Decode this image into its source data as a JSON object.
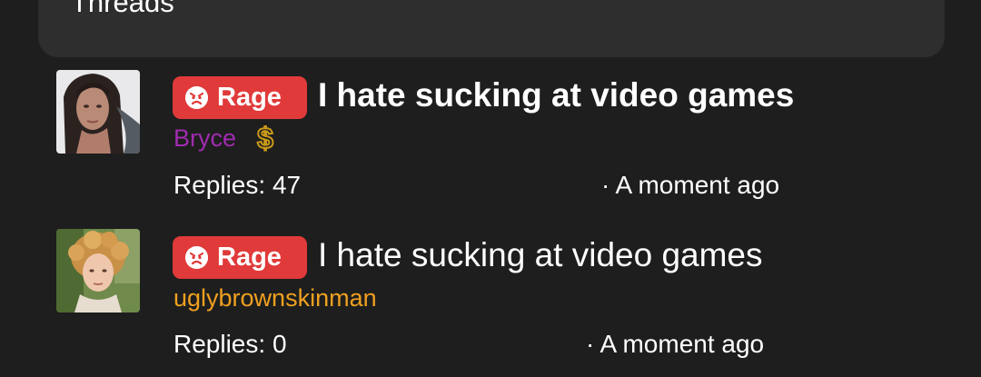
{
  "header": {
    "title": "Threads"
  },
  "threads": [
    {
      "tag": {
        "label": "Rage",
        "icon": "angry-face-icon",
        "color": "#e03a3a"
      },
      "title": "I hate sucking at video games",
      "author": "Bryce",
      "author_color": "#a02cb0",
      "author_badge_icon": "dollar-icon",
      "replies": "Replies: 47",
      "time": "· A moment ago"
    },
    {
      "tag": {
        "label": "Rage",
        "icon": "angry-face-icon",
        "color": "#e03a3a"
      },
      "title": "I hate sucking at video games",
      "author": "uglybrownskinman",
      "author_color": "#f0a020",
      "replies": "Replies: 0",
      "time": "· A moment ago"
    }
  ]
}
